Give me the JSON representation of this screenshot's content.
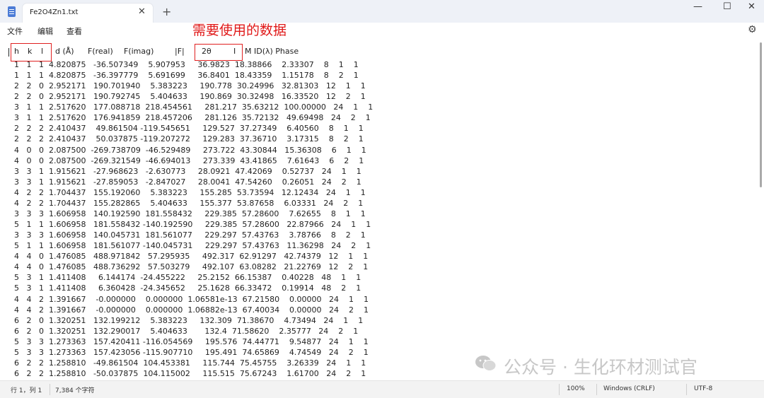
{
  "window": {
    "tab_title": "Fe2O4Zn1.txt",
    "tab_close": "✕",
    "new_tab": "+",
    "minimize": "—",
    "maximize": "☐",
    "close": "✕"
  },
  "menu": {
    "file": "文件",
    "edit": "编辑",
    "view": "查看",
    "settings_icon": "⚙"
  },
  "annotation": "需要使用的数据",
  "header": {
    "h": "h",
    "k": "k",
    "l": "l",
    "d": "d (Å)",
    "freal": "F(real)",
    "fimag": "F(imag)",
    "fabs": "|F|",
    "two_theta": "2θ",
    "intensity": "I",
    "rest": "M ID(λ) Phase"
  },
  "rows": [
    "1   1   1  4.820875   -36.507349    5.907953     36.9823  18.38866    2.33307    8    1    1",
    "1   1   1  4.820875   -36.397779    5.691699     36.8401  18.43359    1.15178    8    2    1",
    "2   2   0  2.952171   190.701940    5.383223     190.778  30.24996   32.81303   12    1    1",
    "2   2   0  2.952171   190.792745    5.404633     190.869  30.32498   16.33520   12    2    1",
    "3   1   1  2.517620   177.088718  218.454561     281.217  35.63212  100.00000   24    1    1",
    "3   1   1  2.517620   176.941859  218.457206     281.126  35.72132   49.69498   24    2    1",
    "2   2   2  2.410437    49.861504 -119.545651     129.527  37.27349    6.40560    8    1    1",
    "2   2   2  2.410437    50.037875 -119.207272     129.283  37.36710    3.17315    8    2    1",
    "4   0   0  2.087500  -269.738709  -46.529489     273.722  43.30844   15.36308    6    1    1",
    "4   0   0  2.087500  -269.321549  -46.694013     273.339  43.41865    7.61643    6    2    1",
    "3   3   1  1.915621   -27.968623   -2.630773     28.0921  47.42069    0.52737   24    1    1",
    "3   3   1  1.915621   -27.859053   -2.847027     28.0041  47.54260    0.26051   24    2    1",
    "4   2   2  1.704437   155.192060    5.383223     155.285  53.73594   12.12434   24    1    1",
    "4   2   2  1.704437   155.282865    5.404633     155.377  53.87658    6.03331   24    2    1",
    "3   3   3  1.606958   140.192590  181.558432     229.385  57.28600    7.62655    8    1    1",
    "5   1   1  1.606958   181.558432 -140.192590     229.385  57.28600   22.87966   24    1    1",
    "3   3   3  1.606958   140.045731  181.561077     229.297  57.43763    3.78766    8    2    1",
    "5   1   1  1.606958   181.561077 -140.045731     229.297  57.43763   11.36298   24    2    1",
    "4   4   0  1.476085   488.971842   57.295935     492.317  62.91297   42.74379   12    1    1",
    "4   4   0  1.476085   488.736292   57.503279     492.107  63.08282   21.22769   12    2    1",
    "5   3   1  1.411408     6.144174  -24.455222     25.2152  66.15387    0.40228   48    1    1",
    "5   3   1  1.411408     6.360428  -24.345652     25.1628  66.33472    0.19914   48    2    1",
    "4   4   2  1.391667    -0.000000    0.000000  1.06581e-13  67.21580    0.00000   24    1    1",
    "4   4   2  1.391667    -0.000000    0.000000  1.06882e-13  67.40034    0.00000   24    2    1",
    "6   2   0  1.320251   132.199212    5.383223     132.309  71.38670    4.73494   24    1    1",
    "6   2   0  1.320251   132.290017    5.404633       132.4  71.58620    2.35777   24    2    1",
    "5   3   3  1.273363   157.420411 -116.054569     195.576  74.44771    9.54877   24    1    1",
    "5   3   3  1.273363   157.423056 -115.907710     195.491  74.65869    4.74549   24    2    1",
    "6   2   2  1.258810   -49.861504  104.453381     115.744  75.45755    3.26339   24    1    1",
    "6   2   2  1.258810   -50.037875  104.115002     115.515  75.67243    1.61700   24    2    1"
  ],
  "status": {
    "position": "行 1，列 1",
    "chars": "7,384 个字符",
    "zoom": "100%",
    "line_ending": "Windows (CRLF)",
    "encoding": "UTF-8"
  },
  "watermark": "公众号 · 生化环材测试官"
}
